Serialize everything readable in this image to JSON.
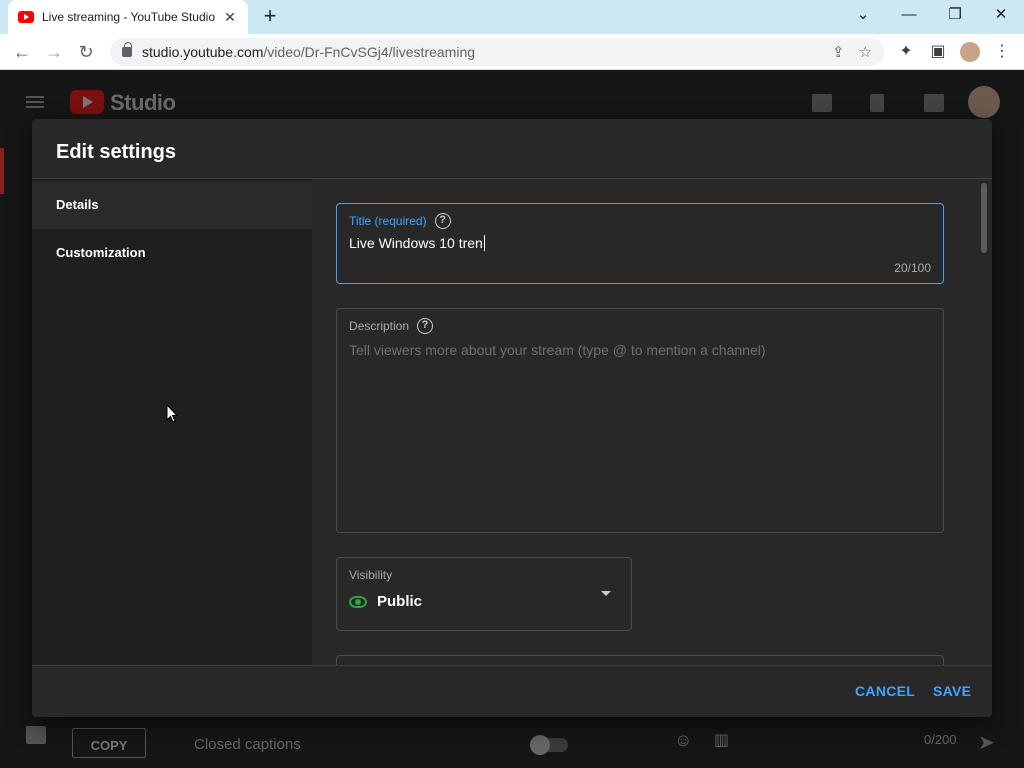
{
  "browser": {
    "tab_title": "Live streaming - YouTube Studio",
    "url_host": "studio.youtube.com",
    "url_path": "/video/Dr-FnCvSGj4/livestreaming"
  },
  "studio": {
    "logo_text": "Studio",
    "copy_label": "COPY",
    "closed_captions_label": "Closed captions",
    "chat_counter": "0/200"
  },
  "modal": {
    "title": "Edit settings",
    "sidebar": [
      {
        "label": "Details"
      },
      {
        "label": "Customization"
      }
    ],
    "title_field": {
      "label": "Title (required)",
      "value": "Live Windows 10 tren",
      "counter": "20/100"
    },
    "description_field": {
      "label": "Description",
      "placeholder": "Tell viewers more about your stream (type @ to mention a channel)"
    },
    "visibility": {
      "label": "Visibility",
      "value": "Public"
    },
    "cancel_label": "CANCEL",
    "save_label": "SAVE"
  },
  "colors": {
    "accent": "#3ea6ff",
    "public_green": "#2ba640",
    "brand_red": "#ff0000"
  }
}
